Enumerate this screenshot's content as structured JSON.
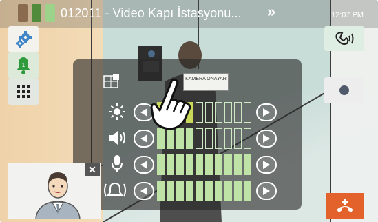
{
  "header": {
    "title": "012011 - Video Kapı İstasyonu...",
    "time": "12:07 PM",
    "status_bar_colors": [
      "#8a6b4e",
      "#4f8b3a",
      "#9dd28a"
    ]
  },
  "sidebar": {
    "items": [
      {
        "icon": "gear-icon",
        "color": "#3f86c8"
      },
      {
        "icon": "bell-icon",
        "badge": "1",
        "color": "#2f9a3c"
      },
      {
        "icon": "keypad-icon",
        "color": "#333333"
      }
    ]
  },
  "overlay_label": "KAMERA ONAYAR",
  "adjustments": [
    {
      "name": "brightness",
      "icon": "sun-icon",
      "level": 4,
      "max": 10,
      "fill_color": "#c9d75a"
    },
    {
      "name": "speaker-volume",
      "icon": "speaker-icon",
      "level": 4,
      "max": 10,
      "fill_color": "#bfe3a6"
    },
    {
      "name": "microphone-volume",
      "icon": "microphone-icon",
      "level": 10,
      "max": 10,
      "fill_color": "#bfe3a6"
    },
    {
      "name": "ringtone-volume",
      "icon": "bell-ring-icon",
      "level": 10,
      "max": 10,
      "fill_color": "#bfe3a6"
    }
  ],
  "colors": {
    "end_call": "#e3622c",
    "accent_green": "#2f9a3c"
  }
}
